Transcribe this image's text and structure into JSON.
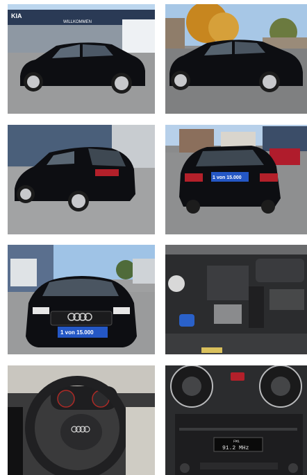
{
  "gallery": {
    "photos": [
      {
        "alt": "",
        "dealer_sign": "KIA",
        "dealer_banner": "WILLKOMMEN"
      },
      {
        "alt": ""
      },
      {
        "alt": ""
      },
      {
        "alt": "",
        "plate": "1 von 15.000"
      },
      {
        "alt": "",
        "plate": "1 von 15.000",
        "badge": "AUDI"
      },
      {
        "alt": ""
      },
      {
        "alt": ""
      },
      {
        "alt": "",
        "radio_display": "91.2 MHz",
        "radio_band": "FM1"
      }
    ]
  },
  "colors": {
    "car_body": "#0d0e12",
    "sky": "#9fc3e6",
    "asphalt": "#8e8f90",
    "plate_blue": "#2457c5"
  }
}
